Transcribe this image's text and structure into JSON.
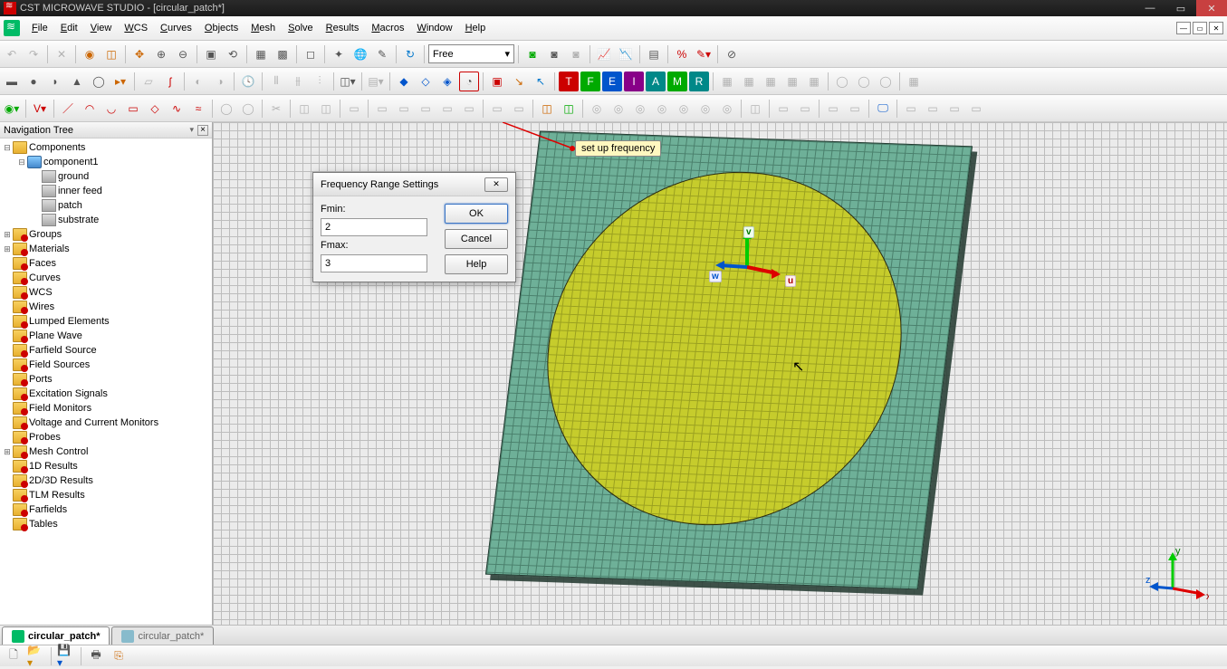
{
  "titlebar": {
    "app": "CST MICROWAVE STUDIO",
    "doc": "[circular_patch*]"
  },
  "menus": [
    "File",
    "Edit",
    "View",
    "WCS",
    "Curves",
    "Objects",
    "Mesh",
    "Solve",
    "Results",
    "Macros",
    "Window",
    "Help"
  ],
  "toolbar1": {
    "dropdown": "Free"
  },
  "nav": {
    "header": "Navigation Tree",
    "root": "Components",
    "component1": "component1",
    "parts": [
      "ground",
      "inner feed",
      "patch",
      "substrate"
    ],
    "folders": [
      "Groups",
      "Materials",
      "Faces",
      "Curves",
      "WCS",
      "Wires",
      "Lumped Elements",
      "Plane Wave",
      "Farfield Source",
      "Field Sources",
      "Ports",
      "Excitation Signals",
      "Field Monitors",
      "Voltage and Current Monitors",
      "Probes",
      "Mesh Control",
      "1D Results",
      "2D/3D Results",
      "TLM Results",
      "Farfields",
      "Tables"
    ]
  },
  "annotation": "set up frequency",
  "axes": {
    "u": "u",
    "v": "v",
    "w": "w"
  },
  "dialog": {
    "title": "Frequency Range Settings",
    "fmin_label": "Fmin:",
    "fmin": "2",
    "fmax_label": "Fmax:",
    "fmax": "3",
    "ok": "OK",
    "cancel": "Cancel",
    "help": "Help"
  },
  "tabs": {
    "active": "circular_patch*",
    "inactive": "circular_patch*"
  },
  "compass": {
    "x": "x",
    "y": "y",
    "z": "z"
  }
}
